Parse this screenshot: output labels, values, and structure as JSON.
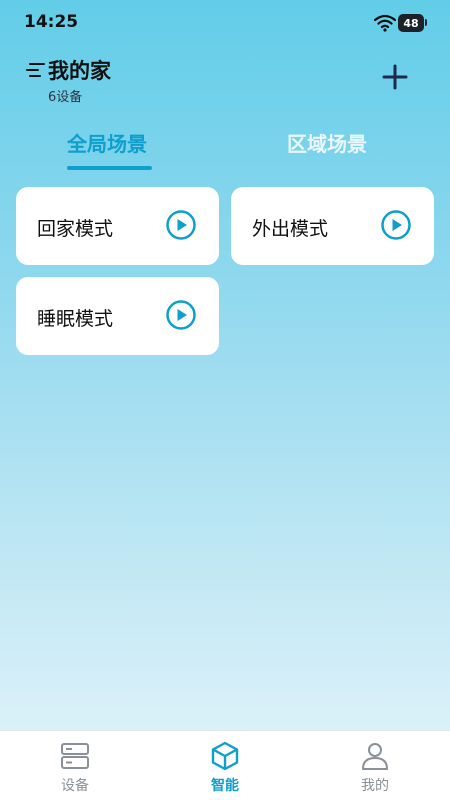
{
  "status_bar": {
    "time": "14:25",
    "battery": "48"
  },
  "header": {
    "title": "我的家",
    "subtitle": "6设备"
  },
  "tabs": [
    {
      "label": "全局场景"
    },
    {
      "label": "区域场景"
    }
  ],
  "scenes": [
    {
      "label": "回家模式"
    },
    {
      "label": "外出模式"
    },
    {
      "label": "睡眠模式"
    }
  ],
  "bottom_nav": [
    {
      "label": "设备",
      "icon": "devices-icon"
    },
    {
      "label": "智能",
      "icon": "smart-cube-icon"
    },
    {
      "label": "我的",
      "icon": "person-icon"
    }
  ],
  "colors": {
    "accent": "#0e9fcc",
    "icon_dark": "#1e2a4a",
    "inactive": "#8a9098"
  }
}
